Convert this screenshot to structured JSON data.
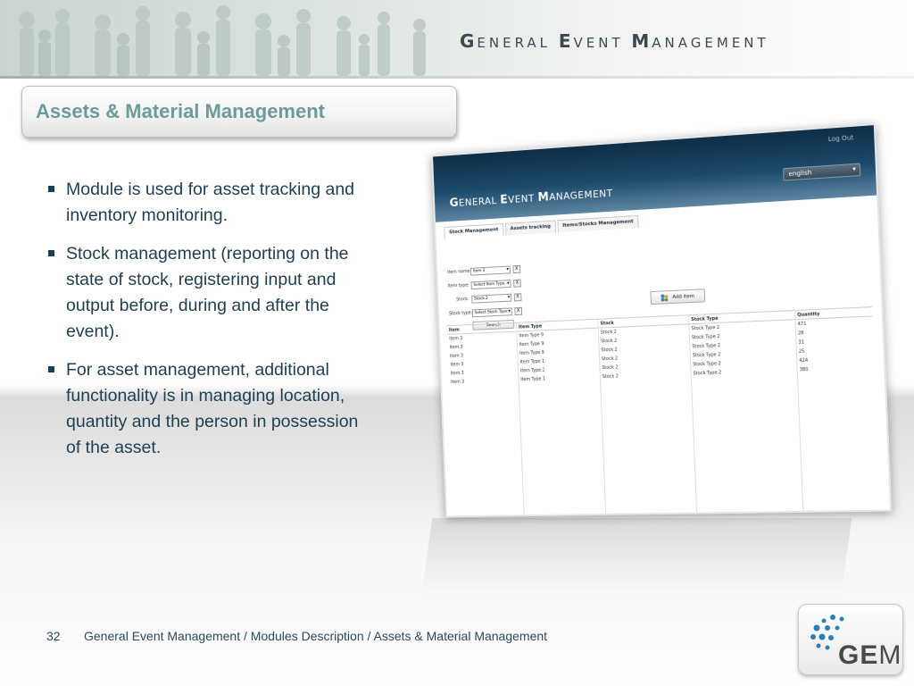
{
  "header": {
    "brand": {
      "g": "G",
      "eneral": "ENERAL",
      "e": "E",
      "vent": "VENT",
      "m": "M",
      "anagement": "ANAGEMENT"
    }
  },
  "slide": {
    "title": "Assets & Material Management",
    "bullets": [
      "Module is used for asset tracking and inventory monitoring.",
      "Stock management (reporting on the state of stock, registering input and output before, during and after the event).",
      "For asset management, additional functionality is in managing location, quantity and the person in possession of the asset."
    ]
  },
  "app": {
    "logout": "Log Out",
    "language": "english",
    "title": {
      "g": "G",
      "eneral": "ENERAL ",
      "e": "E",
      "vent": "VENT ",
      "m": "M",
      "anagement": "ANAGEMENT"
    },
    "tabs": [
      "Stock Management",
      "Assets tracking",
      "Items/Stocks Management"
    ],
    "form": [
      {
        "label": "Item name:",
        "value": "Item 3"
      },
      {
        "label": "Item type:",
        "value": "Select Item Type..."
      },
      {
        "label": "Stock:",
        "value": "Stock 2"
      },
      {
        "label": "Stock type:",
        "value": "Select Stock Type..."
      }
    ],
    "clear_glyph": "X",
    "search_label": "Search",
    "add_item_label": "Add item",
    "columns": [
      "Item",
      "Item Type",
      "Stock",
      "Stock Type",
      "Quantity"
    ],
    "rows": [
      [
        "Item 3",
        "Item Type 9",
        "Stock 2",
        "Stock Type 2",
        "471"
      ],
      [
        "Item 3",
        "Item Type 9",
        "Stock 2",
        "Stock Type 2",
        "28"
      ],
      [
        "Item 3",
        "Item Type 9",
        "Stock 2",
        "Stock Type 2",
        "31"
      ],
      [
        "Item 3",
        "Item Type 1",
        "Stock 2",
        "Stock Type 2",
        "25"
      ],
      [
        "Item 3",
        "Item Type 2",
        "Stock 2",
        "Stock Type 2",
        "424"
      ],
      [
        "Item 3",
        "Item Type 1",
        "Stock 2",
        "Stock Type 2",
        "380"
      ]
    ]
  },
  "footer": {
    "page_number": "32",
    "breadcrumb": "General Event Management / Modules Description / Assets & Material Management"
  },
  "logo": {
    "ge": "GE",
    "m": "M"
  },
  "colors": {
    "title": "#6e9a9b",
    "body_text": "#1e3f52",
    "app_header": "#1c4a6b",
    "logo_dots": "#2a7fb8"
  }
}
